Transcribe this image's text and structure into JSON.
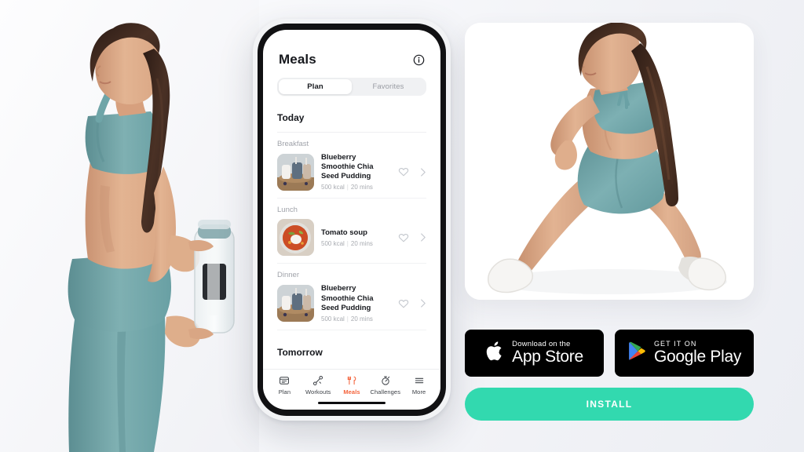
{
  "colors": {
    "install_button": "#32d9af",
    "active_tab": "#f4623a",
    "badge_background": "#000000",
    "activewear_teal": "#6fa5a8",
    "page_background": "#f5f6f9"
  },
  "phone": {
    "app": {
      "title": "Meals",
      "info_icon": "info-circle-icon",
      "segmented": {
        "options": [
          "Plan",
          "Favorites"
        ],
        "selected": "Plan"
      },
      "sections": [
        {
          "day": "Today",
          "meals": [
            {
              "label": "Breakfast",
              "name": "Blueberry Smoothie Chia Seed Pudding",
              "calories": "500 kcal",
              "duration": "20 mins",
              "thumb": "blueberry-smoothie-photo",
              "favorite_icon": "heart-outline-icon",
              "chevron_icon": "chevron-right-icon"
            },
            {
              "label": "Lunch",
              "name": "Tomato soup",
              "calories": "500 kcal",
              "duration": "20 mins",
              "thumb": "tomato-soup-photo",
              "favorite_icon": "heart-outline-icon",
              "chevron_icon": "chevron-right-icon"
            },
            {
              "label": "Dinner",
              "name": "Blueberry Smoothie Chia Seed Pudding",
              "calories": "500 kcal",
              "duration": "20 mins",
              "thumb": "blueberry-smoothie-photo",
              "favorite_icon": "heart-outline-icon",
              "chevron_icon": "chevron-right-icon"
            }
          ]
        },
        {
          "day": "Tomorrow",
          "meals": []
        }
      ],
      "tabs": [
        {
          "label": "Plan",
          "icon": "calendar-plan-icon",
          "active": false
        },
        {
          "label": "Workouts",
          "icon": "dumbbell-icon",
          "active": false
        },
        {
          "label": "Meals",
          "icon": "cutlery-icon",
          "active": true
        },
        {
          "label": "Challenges",
          "icon": "stopwatch-icon",
          "active": false
        },
        {
          "label": "More",
          "icon": "hamburger-menu-icon",
          "active": false
        }
      ]
    }
  },
  "hero": {
    "photo": "woman-lunge-stretch-photo",
    "alt": "Woman in teal activewear performing a side lunge stretch"
  },
  "left_photo": {
    "photo": "woman-holding-water-bottle-photo",
    "alt": "Woman in teal sports bra and leggings holding a water bottle"
  },
  "store_badges": [
    {
      "icon": "apple-logo-icon",
      "small": "Download on the",
      "big": "App Store"
    },
    {
      "icon": "google-play-logo-icon",
      "small": "GET IT ON",
      "big": "Google Play"
    }
  ],
  "cta": {
    "install_label": "INSTALL"
  }
}
